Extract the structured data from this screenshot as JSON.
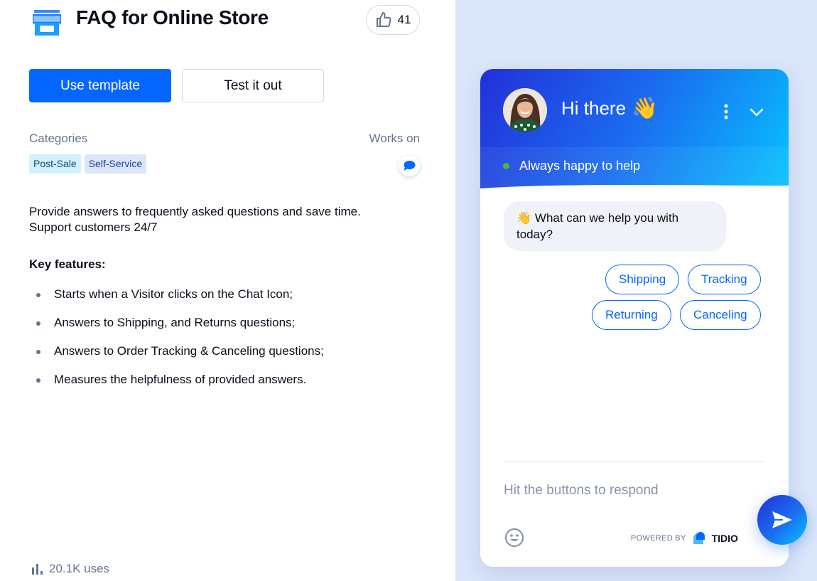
{
  "header": {
    "title": "FAQ for Online Store",
    "icon": "store-icon",
    "likes": "41"
  },
  "actions": {
    "use_template": "Use template",
    "test_it_out": "Test it out"
  },
  "meta": {
    "categories_label": "Categories",
    "works_on_label": "Works on",
    "tags": [
      "Post-Sale",
      "Self-Service"
    ],
    "works_on_icon": "chat-bubble-icon"
  },
  "description": {
    "line1": "Provide answers to frequently asked questions and save time.",
    "line2": "Support customers 24/7"
  },
  "key_features": {
    "title": "Key features:",
    "items": [
      "Starts when a Visitor clicks on the Chat Icon;",
      "Answers to Shipping, and Returns questions;",
      "Answers to Order Tracking & Canceling questions;",
      "Measures the helpfulness of provided answers."
    ]
  },
  "stats": {
    "uses": "20.1K uses"
  },
  "chat": {
    "greeting": "Hi there",
    "greeting_emoji": "👋",
    "status": "Always happy to help",
    "status_color": "#4cba3c",
    "message_emoji": "👋",
    "message": "What can we help you with today?",
    "quick_replies": [
      "Shipping",
      "Tracking",
      "Returning",
      "Canceling"
    ],
    "input_placeholder": "Hit the buttons to respond",
    "powered_by": "POWERED BY",
    "brand": "TIDIO",
    "accent": "#0566ff"
  }
}
